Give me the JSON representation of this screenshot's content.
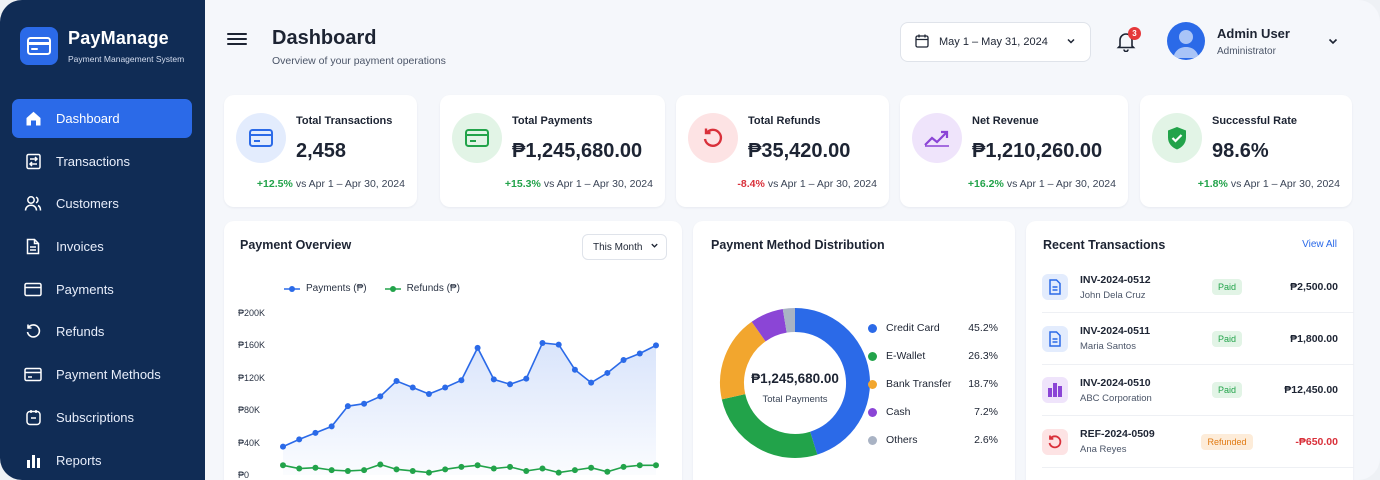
{
  "brand": {
    "name": "PayManage",
    "subtitle": "Payment Management System"
  },
  "nav": [
    {
      "label": "Dashboard",
      "icon": "home-icon",
      "active": true
    },
    {
      "label": "Transactions",
      "icon": "transactions-icon"
    },
    {
      "label": "Customers",
      "icon": "customers-icon"
    },
    {
      "label": "Invoices",
      "icon": "invoice-icon"
    },
    {
      "label": "Payments",
      "icon": "card-icon"
    },
    {
      "label": "Refunds",
      "icon": "refund-icon"
    },
    {
      "label": "Payment Methods",
      "icon": "wallet-icon"
    },
    {
      "label": "Subscriptions",
      "icon": "subscription-icon"
    },
    {
      "label": "Reports",
      "icon": "bar-chart-icon"
    }
  ],
  "header": {
    "title": "Dashboard",
    "subtitle": "Overview of your payment operations",
    "date_range": "May 1 – May 31, 2024",
    "notif_count": "3",
    "user_name": "Admin User",
    "user_role": "Administrator"
  },
  "stats": [
    {
      "label": "Total Transactions",
      "value": "2,458",
      "change": "+12.5%",
      "period": "vs Apr 1 – Apr 30, 2024",
      "positive": true,
      "icon": "card-icon",
      "color": "#2b6ae8",
      "bg": "#e3ecfd"
    },
    {
      "label": "Total Payments",
      "value": "₱1,245,680.00",
      "change": "+15.3%",
      "period": "vs Apr 1 – Apr 30, 2024",
      "positive": true,
      "icon": "card-icon",
      "color": "#22a34a",
      "bg": "#e2f4e6"
    },
    {
      "label": "Total Refunds",
      "value": "₱35,420.00",
      "change": "-8.4%",
      "period": "vs Apr 1 – Apr 30, 2024",
      "positive": false,
      "icon": "refund-icon",
      "color": "#d9303a",
      "bg": "#fde3e4"
    },
    {
      "label": "Net Revenue",
      "value": "₱1,210,260.00",
      "change": "+16.2%",
      "period": "vs Apr 1 – Apr 30, 2024",
      "positive": true,
      "icon": "trend-up-icon",
      "color": "#8b45d6",
      "bg": "#efe4fb"
    },
    {
      "label": "Successful Rate",
      "value": "98.6%",
      "change": "+1.8%",
      "period": "vs Apr 1 – Apr 30, 2024",
      "positive": true,
      "icon": "shield-check-icon",
      "color": "#22a34a",
      "bg": "#e2f4e6"
    }
  ],
  "overview": {
    "title": "Payment Overview",
    "filter": "This Month",
    "chart_data": {
      "type": "area",
      "series": [
        {
          "name": "Payments (₱)",
          "color": "#2b6ae8",
          "values": [
            35,
            44,
            52,
            60,
            85,
            88,
            97,
            116,
            108,
            100,
            108,
            117,
            157,
            118,
            112,
            119,
            163,
            161,
            130,
            114,
            126,
            142,
            150,
            160
          ]
        },
        {
          "name": "Refunds (₱)",
          "color": "#22a34a",
          "values": [
            12,
            8,
            9,
            6,
            5,
            6,
            13,
            7,
            5,
            3,
            7,
            10,
            12,
            8,
            10,
            5,
            8,
            3,
            6,
            9,
            4,
            10,
            12,
            12
          ]
        }
      ],
      "yticks": [
        "₱200K",
        "₱160K",
        "₱120K",
        "₱80K",
        "₱40K",
        "₱0"
      ],
      "ylim": [
        0,
        200
      ]
    }
  },
  "distribution": {
    "title": "Payment Method Distribution",
    "center_value": "₱1,245,680.00",
    "center_label": "Total Payments",
    "chart_data": {
      "type": "pie",
      "slices": [
        {
          "name": "Credit Card",
          "pct": "45.2%",
          "value": 45.2,
          "color": "#2b6ae8"
        },
        {
          "name": "E-Wallet",
          "pct": "26.3%",
          "value": 26.3,
          "color": "#22a34a"
        },
        {
          "name": "Bank Transfer",
          "pct": "18.7%",
          "value": 18.7,
          "color": "#f2a62e"
        },
        {
          "name": "Cash",
          "pct": "7.2%",
          "value": 7.2,
          "color": "#8b45d6"
        },
        {
          "name": "Others",
          "pct": "2.6%",
          "value": 2.6,
          "color": "#a9b3c4"
        }
      ]
    }
  },
  "recent": {
    "title": "Recent Transactions",
    "view_all": "View All",
    "rows": [
      {
        "id": "INV-2024-0512",
        "name": "John Dela Cruz",
        "status": "Paid",
        "amount": "₱2,500.00",
        "icon": "invoice-icon",
        "kind": "paid"
      },
      {
        "id": "INV-2024-0511",
        "name": "Maria Santos",
        "status": "Paid",
        "amount": "₱1,800.00",
        "icon": "invoice-icon",
        "kind": "paid"
      },
      {
        "id": "INV-2024-0510",
        "name": "ABC Corporation",
        "status": "Paid",
        "amount": "₱12,450.00",
        "icon": "building-icon",
        "kind": "paid"
      },
      {
        "id": "REF-2024-0509",
        "name": "Ana Reyes",
        "status": "Refunded",
        "amount": "-₱650.00",
        "icon": "refund-icon",
        "kind": "refund"
      }
    ]
  }
}
